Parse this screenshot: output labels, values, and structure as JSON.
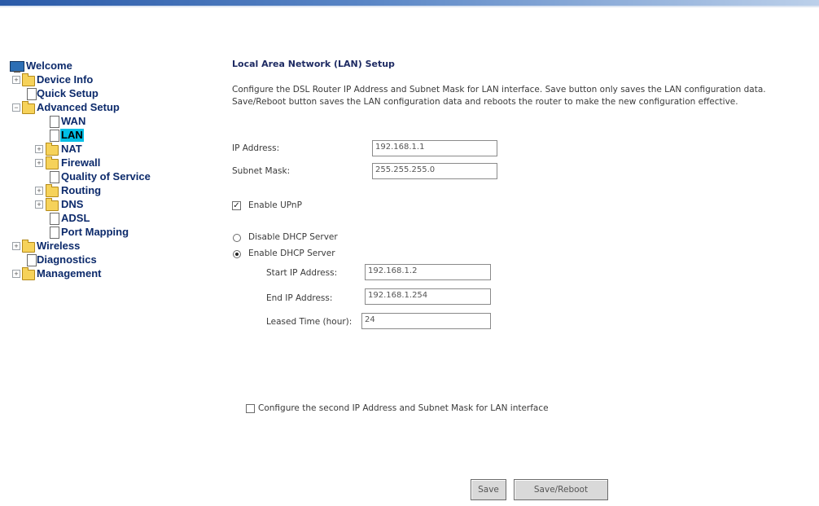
{
  "sidebar": {
    "items": [
      {
        "label": "Welcome"
      },
      {
        "label": "Device Info"
      },
      {
        "label": "Quick Setup"
      },
      {
        "label": "Advanced Setup"
      },
      {
        "label": "WAN"
      },
      {
        "label": "LAN"
      },
      {
        "label": "NAT"
      },
      {
        "label": "Firewall"
      },
      {
        "label": "Quality of Service"
      },
      {
        "label": "Routing"
      },
      {
        "label": "DNS"
      },
      {
        "label": "ADSL"
      },
      {
        "label": "Port Mapping"
      },
      {
        "label": "Wireless"
      },
      {
        "label": "Diagnostics"
      },
      {
        "label": "Management"
      }
    ],
    "selected": "LAN",
    "colors": {
      "selected_bg": "#00bfe6",
      "text": "#0c2a6b",
      "folder": "#f6d25a"
    }
  },
  "main": {
    "title": "Local Area Network (LAN) Setup",
    "description": "Configure the DSL Router IP Address and Subnet Mask for LAN interface.  Save button only saves the LAN configuration data.  Save/Reboot button saves the LAN configuration data and reboots the router to make the new configuration effective.",
    "ip_address": {
      "label": "IP Address:",
      "value": "192.168.1.1"
    },
    "subnet_mask": {
      "label": "Subnet Mask:",
      "value": "255.255.255.0"
    },
    "upnp": {
      "label": "Enable UPnP",
      "checked": true
    },
    "dhcp": {
      "disable_label": "Disable DHCP Server",
      "enable_label": "Enable DHCP Server",
      "selected": "enable",
      "start_ip": {
        "label": "Start IP Address:",
        "value": "192.168.1.2"
      },
      "end_ip": {
        "label": "End IP Address:",
        "value": "192.168.1.254"
      },
      "lease": {
        "label": "Leased Time (hour):",
        "value": "24"
      }
    },
    "second_ip": {
      "label": "Configure the second IP Address and Subnet Mask for LAN interface",
      "checked": false
    },
    "buttons": {
      "save": "Save",
      "save_reboot": "Save/Reboot"
    }
  }
}
